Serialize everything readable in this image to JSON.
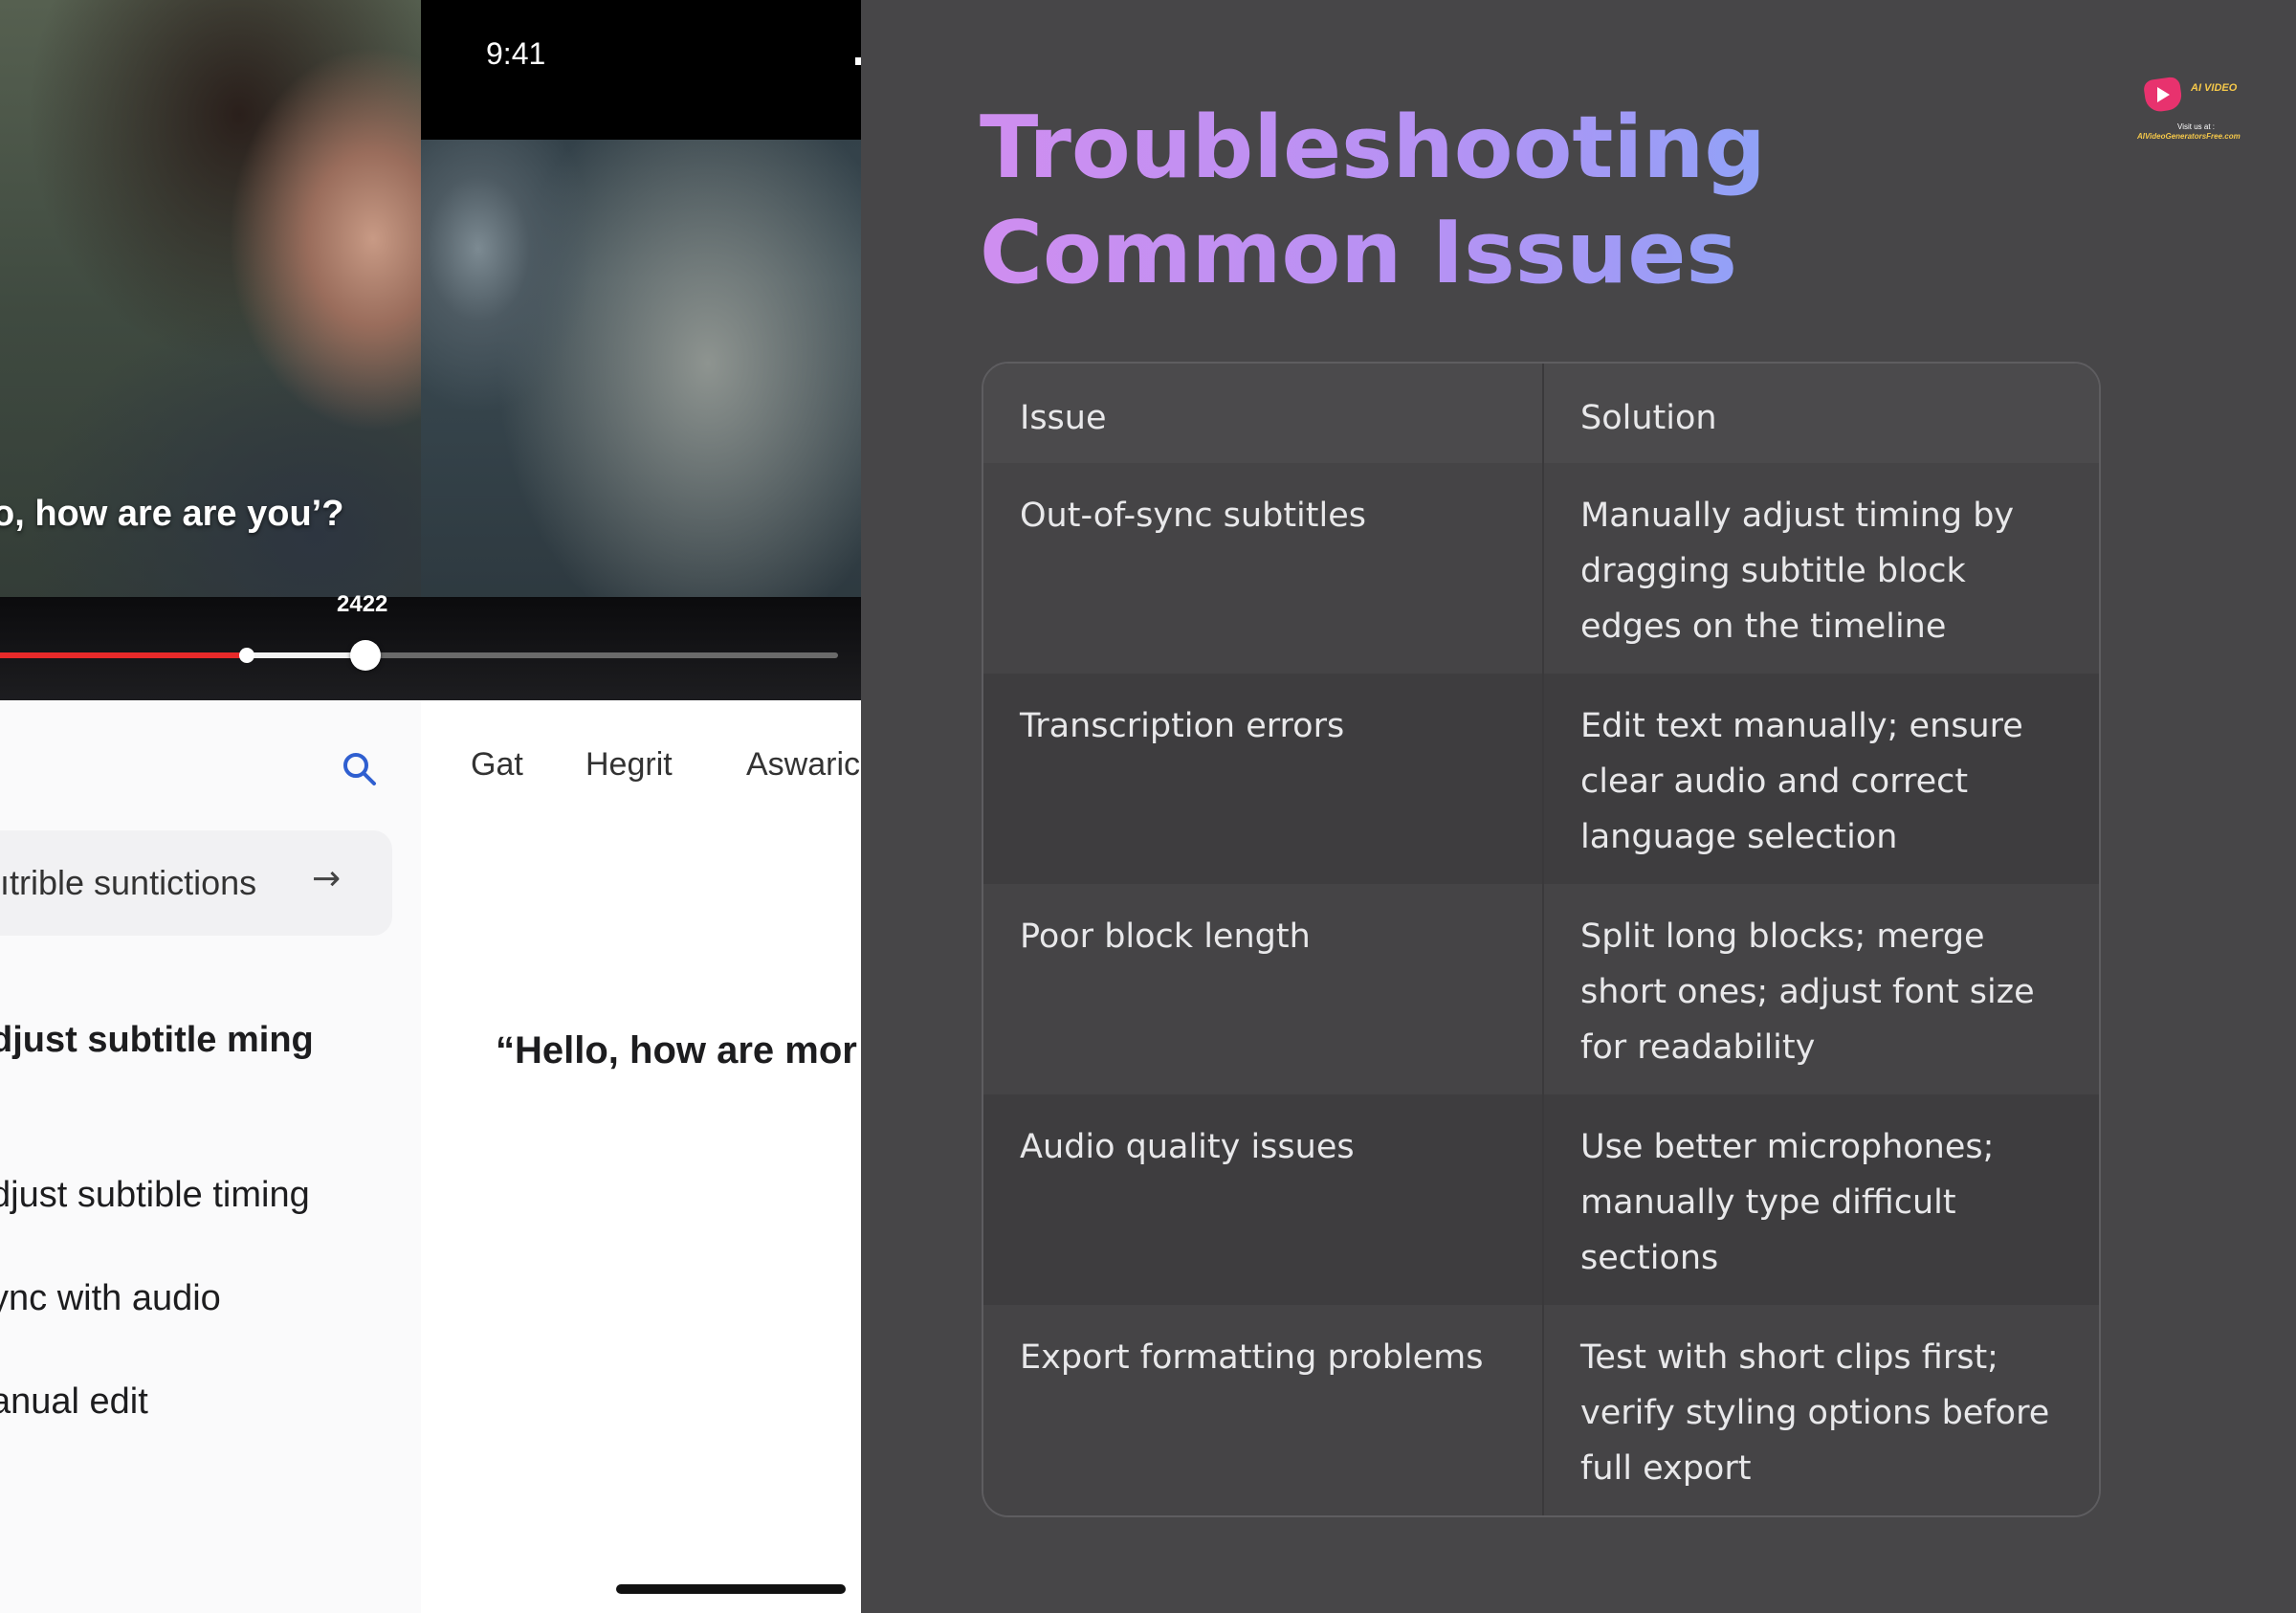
{
  "phone": {
    "status_time": "9:41",
    "video_caption": "o, how are are you’?",
    "scrub_label": "2422",
    "tabs": [
      "Gat",
      "Hegrit",
      "Aswaric"
    ],
    "suggestion_chip": "ıtrible suntictions",
    "side_heading": "djust subtitle ming",
    "side_items": [
      "djust subtible timing",
      "ync with audio",
      "anual edit"
    ],
    "quote": "“Hello, how are mor"
  },
  "slide": {
    "title": "Troubleshooting Common Issues",
    "logo": {
      "line1": "AI VIDEO",
      "line2": "Visit us at :",
      "line3": "AIVideoGeneratorsFree.com"
    },
    "table": {
      "headers": [
        "Issue",
        "Solution"
      ],
      "rows": [
        {
          "issue": "Out-of-sync subtitles",
          "solution": "Manually adjust timing by dragging subtitle block edges on the timeline"
        },
        {
          "issue": "Transcription errors",
          "solution": "Edit text manually; ensure clear audio and correct language selection"
        },
        {
          "issue": "Poor block length",
          "solution": "Split long blocks; merge short ones; adjust font size for readability"
        },
        {
          "issue": "Audio quality issues",
          "solution": "Use better microphones; manually type difficult sections"
        },
        {
          "issue": "Export formatting problems",
          "solution": "Test with short clips first; verify styling options before full export"
        }
      ]
    }
  },
  "colors": {
    "background": "#474648",
    "title_gradient_start": "#cf8ef0",
    "title_gradient_end": "#79b0fa",
    "progress_played": "#e82a2a",
    "search_icon": "#2f5fd0"
  },
  "icons": [
    "search-icon",
    "arrow-right-icon",
    "logo-heart-play-icon"
  ]
}
